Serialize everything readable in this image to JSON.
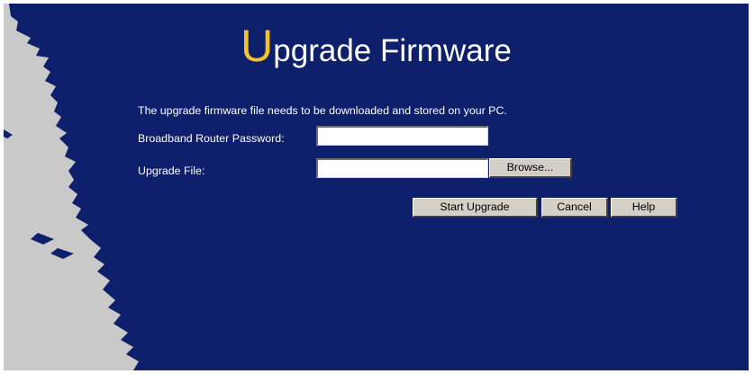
{
  "page": {
    "title_initial": "U",
    "title_rest": "pgrade Firmware",
    "description": "The upgrade firmware file needs to be downloaded and stored on your PC."
  },
  "form": {
    "password_label": "Broadband Router Password:",
    "password_value": "",
    "file_label": "Upgrade File:",
    "file_value": "",
    "browse_label": "Browse..."
  },
  "actions": {
    "start_label": "Start Upgrade",
    "cancel_label": "Cancel",
    "help_label": "Help"
  },
  "colors": {
    "panel_background": "#0e1f6b",
    "title_accent": "#f2c12e",
    "torn_edge": "#c9c9c9"
  }
}
